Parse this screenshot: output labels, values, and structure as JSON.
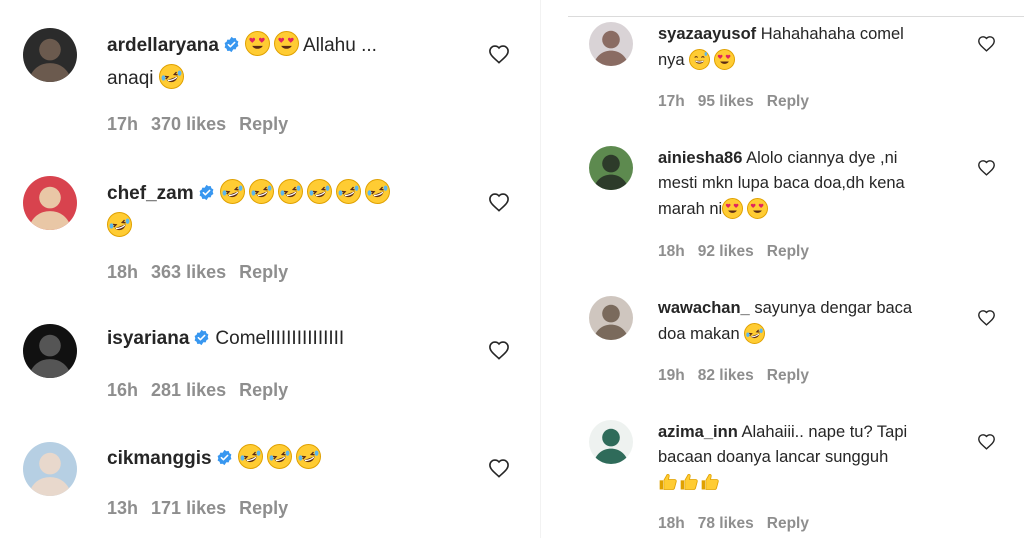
{
  "left_comments": [
    {
      "username": "ardellaryana",
      "verified": true,
      "text_before": "",
      "emojis_before": [
        "heart-eyes-emoji",
        "heart-eyes-emoji"
      ],
      "text": "Allahu ...",
      "line2_text": "anaqi",
      "line2_emojis": [
        "laughing-tears-emoji"
      ],
      "time": "17h",
      "likes": "370 likes",
      "reply": "Reply",
      "avatar_colors": [
        "#2b2b2b",
        "#6b5a4e"
      ]
    },
    {
      "username": "chef_zam",
      "verified": true,
      "emojis_before": [
        "laughing-tears-emoji",
        "laughing-tears-emoji",
        "laughing-tears-emoji",
        "laughing-tears-emoji",
        "laughing-tears-emoji",
        "laughing-tears-emoji"
      ],
      "line2_emojis": [
        "laughing-tears-emoji"
      ],
      "time": "18h",
      "likes": "363 likes",
      "reply": "Reply",
      "avatar_colors": [
        "#d8434e",
        "#e9c7a6"
      ]
    },
    {
      "username": "isyariana",
      "verified": true,
      "text": "ComelIIIIIIIIIIIIII",
      "time": "16h",
      "likes": "281 likes",
      "reply": "Reply",
      "avatar_colors": [
        "#111111",
        "#555555"
      ]
    },
    {
      "username": "cikmanggis",
      "verified": true,
      "emojis_before": [
        "laughing-tears-emoji",
        "laughing-tears-emoji",
        "laughing-tears-emoji"
      ],
      "time": "13h",
      "likes": "171 likes",
      "reply": "Reply",
      "avatar_colors": [
        "#b6cfe3",
        "#e8d8cc"
      ]
    }
  ],
  "right_comments": [
    {
      "username": "syazaayusof",
      "text": "Hahahahaha comel",
      "line2_text": "nya",
      "line2_emojis": [
        "grin-sweat-emoji",
        "heart-eyes-emoji"
      ],
      "time": "17h",
      "likes": "95 likes",
      "reply": "Reply",
      "avatar_colors": [
        "#d9d3d6",
        "#8a6c63"
      ]
    },
    {
      "username": "ainiesha86",
      "text": "Alolo ciannya dye ,ni",
      "line2_text": "mesti mkn lupa baca doa,dh kena",
      "line3_text": "marah ni",
      "line3_emojis": [
        "heart-eyes-emoji",
        "heart-eyes-emoji"
      ],
      "time": "18h",
      "likes": "92 likes",
      "reply": "Reply",
      "avatar_colors": [
        "#5d8a4f",
        "#2d3b2a"
      ]
    },
    {
      "username": "wawachan_",
      "text": "sayunya dengar baca",
      "line2_text": "doa makan",
      "line2_emojis": [
        "laughing-tears-emoji"
      ],
      "time": "19h",
      "likes": "82 likes",
      "reply": "Reply",
      "avatar_colors": [
        "#cfc6bf",
        "#7a6a5c"
      ]
    },
    {
      "username": "azima_inn",
      "text": "Alahaiii.. nape tu? Tapi",
      "line2_text": "bacaan doanya lancar sungguh",
      "line3_emojis": [
        "thumbs-up-emoji",
        "thumbs-up-emoji",
        "thumbs-up-emoji"
      ],
      "time": "18h",
      "likes": "78 likes",
      "reply": "Reply",
      "avatar_colors": [
        "#eef2f0",
        "#2f6b5a"
      ]
    }
  ],
  "colors": {
    "text": "#262626",
    "meta": "#8e8e8e",
    "verified_blue": "#3897f0",
    "divider": "#dbdbdb"
  },
  "icons": {
    "like": "heart-outline-icon",
    "verified": "verified-badge-icon"
  }
}
